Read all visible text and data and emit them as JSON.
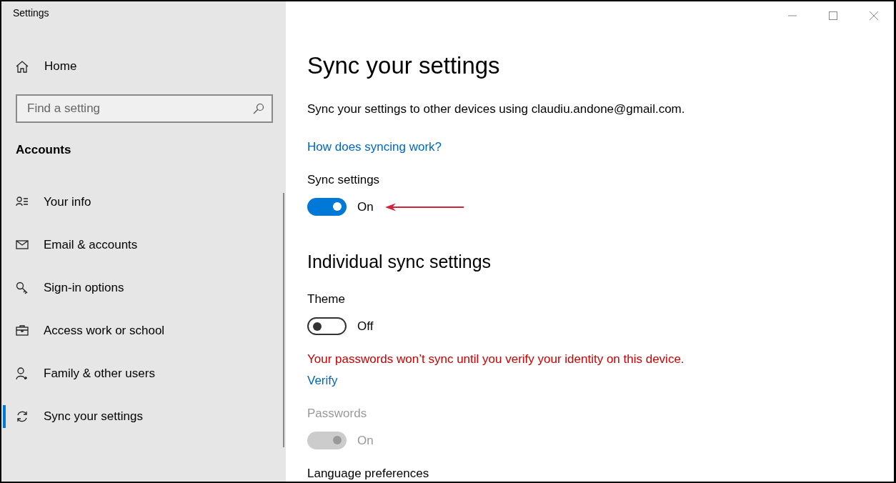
{
  "window": {
    "title": "Settings"
  },
  "sidebar": {
    "home": {
      "label": "Home"
    },
    "search": {
      "placeholder": "Find a setting"
    },
    "section": "Accounts",
    "items": [
      {
        "label": "Your info",
        "selected": false
      },
      {
        "label": "Email & accounts",
        "selected": false
      },
      {
        "label": "Sign-in options",
        "selected": false
      },
      {
        "label": "Access work or school",
        "selected": false
      },
      {
        "label": "Family & other users",
        "selected": false
      },
      {
        "label": "Sync your settings",
        "selected": true
      }
    ]
  },
  "content": {
    "title": "Sync your settings",
    "description": "Sync your settings to other devices using claudiu.andone@gmail.com.",
    "link": "How does syncing work?",
    "blocks": [
      {
        "kind": "toggle",
        "label": "Sync settings",
        "on": true,
        "disabled": false,
        "state_text": "On",
        "arrow": true
      },
      {
        "kind": "heading",
        "text": "Individual sync settings"
      },
      {
        "kind": "toggle",
        "label": "Theme",
        "on": false,
        "disabled": false,
        "state_text": "Off",
        "arrow": false
      },
      {
        "kind": "warning",
        "text": "Your passwords won’t sync until you verify your identity on this device."
      },
      {
        "kind": "link",
        "text": "Verify"
      },
      {
        "kind": "toggle",
        "label": "Passwords",
        "on": true,
        "disabled": true,
        "state_text": "On",
        "arrow": false
      },
      {
        "kind": "label",
        "text": "Language preferences"
      }
    ]
  }
}
